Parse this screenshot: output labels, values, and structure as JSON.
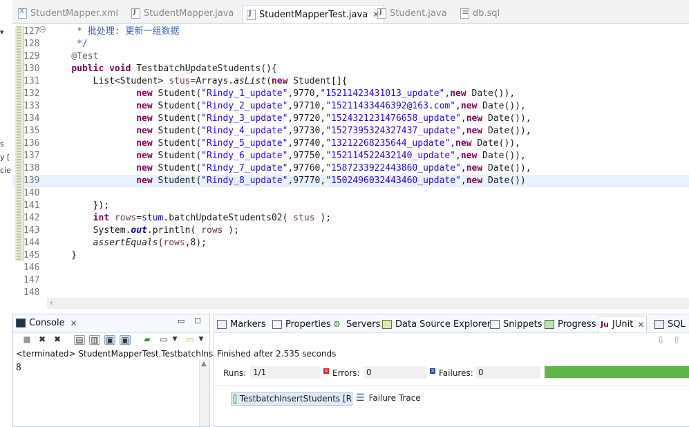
{
  "editor_tabs": [
    {
      "label": "StudentMapper.xml",
      "icon": "xml-file-icon",
      "active": false
    },
    {
      "label": "StudentMapper.java",
      "icon": "java-file-icon",
      "active": false
    },
    {
      "label": "StudentMapperTest.java",
      "icon": "java-file-icon",
      "active": true
    },
    {
      "label": "Student.java",
      "icon": "java-file-icon",
      "active": false
    },
    {
      "label": "db.sql",
      "icon": "sql-file-icon",
      "active": false
    }
  ],
  "close_glyph": "✕",
  "left_strip_fragments": [
    "s",
    "y [",
    "cie"
  ],
  "code_lines": [
    {
      "num": "127",
      "text": "     * 批处理: 更新一组数据"
    },
    {
      "num": "128",
      "text": "     */"
    },
    {
      "num": "129",
      "text": "    @Test"
    },
    {
      "num": "130",
      "text": "    public void TestbatchUpdateStudents(){"
    },
    {
      "num": "131",
      "text": "        List<Student> stus=Arrays.asList(new Student[]{"
    },
    {
      "num": "132",
      "text": "                new Student(\"Rindy_1_update\",9770,\"15211423431013_update\",new Date()),"
    },
    {
      "num": "133",
      "text": "                new Student(\"Rindy_2_update\",97710,\"15211433446392@163.com\",new Date()),"
    },
    {
      "num": "134",
      "text": "                new Student(\"Rindy_3_update\",97720,\"1524321231476658_update\",new Date()),"
    },
    {
      "num": "135",
      "text": "                new Student(\"Rindy_4_update\",97730,\"1527395324327437_update\",new Date()),"
    },
    {
      "num": "136",
      "text": "                new Student(\"Rindy_5_update\",97740,\"13212268235644_update\",new Date()),"
    },
    {
      "num": "137",
      "text": "                new Student(\"Rindy_6_update\",97750,\"152114522432140_update\",new Date()),"
    },
    {
      "num": "138",
      "text": "                new Student(\"Rindy_7_update\",97760,\"1587233922443860_update\",new Date()),"
    },
    {
      "num": "139",
      "text": "                new Student(\"Rindy_8_update\",97770,\"1502496032443460_update\",new Date())"
    },
    {
      "num": "140",
      "text": ""
    },
    {
      "num": "141",
      "text": "        });"
    },
    {
      "num": "142",
      "text": "        int rows=stum.batchUpdateStudents02( stus );"
    },
    {
      "num": "143",
      "text": "        System.out.println( rows );"
    },
    {
      "num": "144",
      "text": "        assertEquals(rows,8);"
    },
    {
      "num": "145",
      "text": "    }"
    },
    {
      "num": "146",
      "text": ""
    },
    {
      "num": "147",
      "text": ""
    },
    {
      "num": "148",
      "text": ""
    }
  ],
  "current_line": "139",
  "console": {
    "tab_label": "Console",
    "status": "<terminated> StudentMapperTest.TestbatchInse",
    "output": "8"
  },
  "views_tabs": [
    {
      "label": "Markers",
      "icon": "markers-icon"
    },
    {
      "label": "Properties",
      "icon": "properties-icon"
    },
    {
      "label": "Servers",
      "icon": "servers-icon"
    },
    {
      "label": "Data Source Explorer",
      "icon": "data-source-icon"
    },
    {
      "label": "Snippets",
      "icon": "snippets-icon"
    },
    {
      "label": "Progress",
      "icon": "progress-icon"
    },
    {
      "label": "JUnit",
      "icon": "junit-icon",
      "active": true
    },
    {
      "label": "SQL R",
      "icon": "sql-results-icon"
    }
  ],
  "junit": {
    "finished": "Finished after 2.535 seconds",
    "runs_label": "Runs:",
    "runs_value": "1/1",
    "errors_label": "Errors:",
    "errors_value": "0",
    "failures_label": "Failures:",
    "failures_value": "0",
    "progress": 1.0,
    "progress_color": "#5fb548",
    "test_item": "TestbatchInsertStudents [R",
    "failure_trace_label": "Failure Trace"
  }
}
